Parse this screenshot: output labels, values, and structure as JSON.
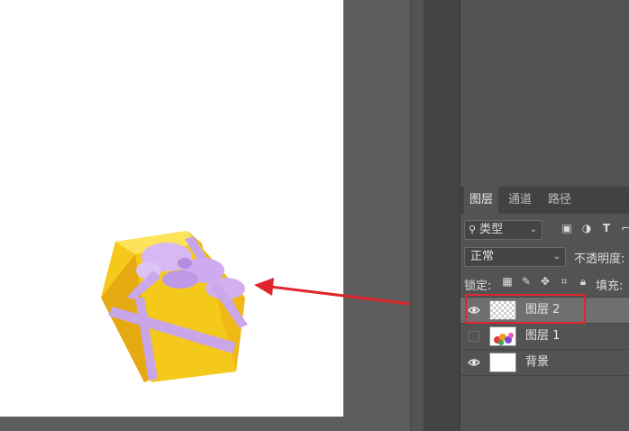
{
  "layers_panel": {
    "tabs": [
      "图层",
      "通道",
      "路径"
    ],
    "filter_kind": "类型",
    "blend_mode": "正常",
    "opacity_label": "不透明度:",
    "lock_label": "锁定:",
    "fill_label": "填充:",
    "layers": [
      {
        "name": "图层 2",
        "visible": true,
        "selected": true
      },
      {
        "name": "图层 1",
        "visible": false,
        "selected": false
      },
      {
        "name": "背景",
        "visible": true,
        "selected": false
      }
    ]
  },
  "colors": {
    "highlight": "#e0262d",
    "arrow": "#e0262d",
    "canvas": "#ffffff",
    "panel": "#535353"
  }
}
